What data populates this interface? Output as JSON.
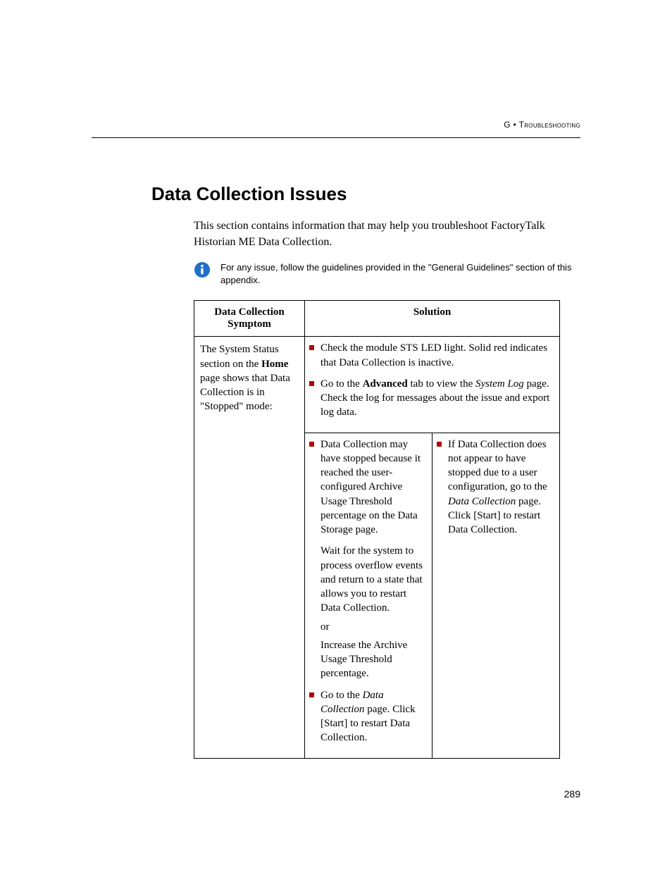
{
  "header": {
    "prefix": "G • ",
    "title": "Troubleshooting"
  },
  "section": {
    "title": "Data Collection Issues",
    "intro": "This section contains information that may help you troubleshoot FactoryTalk Historian ME Data Collection."
  },
  "note": {
    "text": "For any issue, follow the guidelines provided in the \"General Guidelines\" section of this appendix."
  },
  "table": {
    "headers": {
      "symptom": "Data Collection Symptom",
      "solution": "Solution"
    },
    "symptom_parts": {
      "p1": "The System Status section on the ",
      "p1b": "Home",
      "p2": " page shows that Data Collection is in \"Stopped\" mode:"
    },
    "sol_top": {
      "b1": "Check the module STS LED light. Solid red indicates that Data Collection is inactive.",
      "b2a": "Go to the ",
      "b2b": "Advanced",
      "b2c": " tab to view the ",
      "b2d": "System Log",
      "b2e": " page. Check the log for messages about the issue and export log data."
    },
    "sol_left": {
      "b1": "Data Collection may have stopped because it reached the user-configured Archive Usage Threshold percentage on the Data Storage page.",
      "p1": "Wait for the system to process overflow events and return to a state that allows you to restart Data Collection.",
      "p2": "or",
      "p3": "Increase the Archive Usage Threshold percentage.",
      "b2a": "Go to the ",
      "b2b": "Data Collection",
      "b2c": " page. Click [Start] to restart Data Collection."
    },
    "sol_right": {
      "b1a": "If Data Collection does not appear to have stopped due to a user configuration, go to the ",
      "b1b": "Data Collection",
      "b1c": " page. Click [Start] to restart Data Collection."
    }
  },
  "page_number": "289"
}
